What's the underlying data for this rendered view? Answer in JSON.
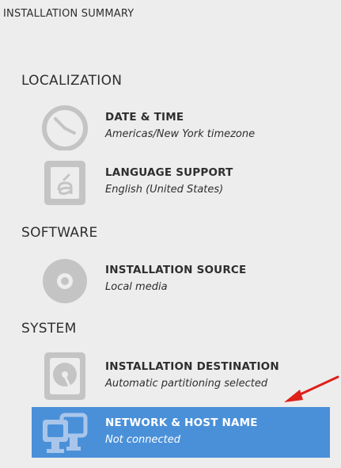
{
  "page_title": "INSTALLATION SUMMARY",
  "sections": {
    "localization": {
      "heading": "LOCALIZATION",
      "spokes": [
        {
          "title": "DATE & TIME",
          "status": "Americas/New York timezone",
          "icon": "clock-icon"
        },
        {
          "title": "LANGUAGE SUPPORT",
          "status": "English (United States)",
          "icon": "language-icon"
        }
      ]
    },
    "software": {
      "heading": "SOFTWARE",
      "spokes": [
        {
          "title": "INSTALLATION SOURCE",
          "status": "Local media",
          "icon": "disc-icon"
        }
      ]
    },
    "system": {
      "heading": "SYSTEM",
      "spokes": [
        {
          "title": "INSTALLATION DESTINATION",
          "status": "Automatic partitioning selected",
          "icon": "hard-drive-icon"
        },
        {
          "title": "NETWORK & HOST NAME",
          "status": "Not connected",
          "icon": "network-icon",
          "selected": true
        }
      ]
    }
  },
  "colors": {
    "background": "#ededed",
    "selected_highlight": "#4a90d9",
    "icon_gray": "#c4c4c4",
    "annotation_arrow": "#e0201b"
  }
}
